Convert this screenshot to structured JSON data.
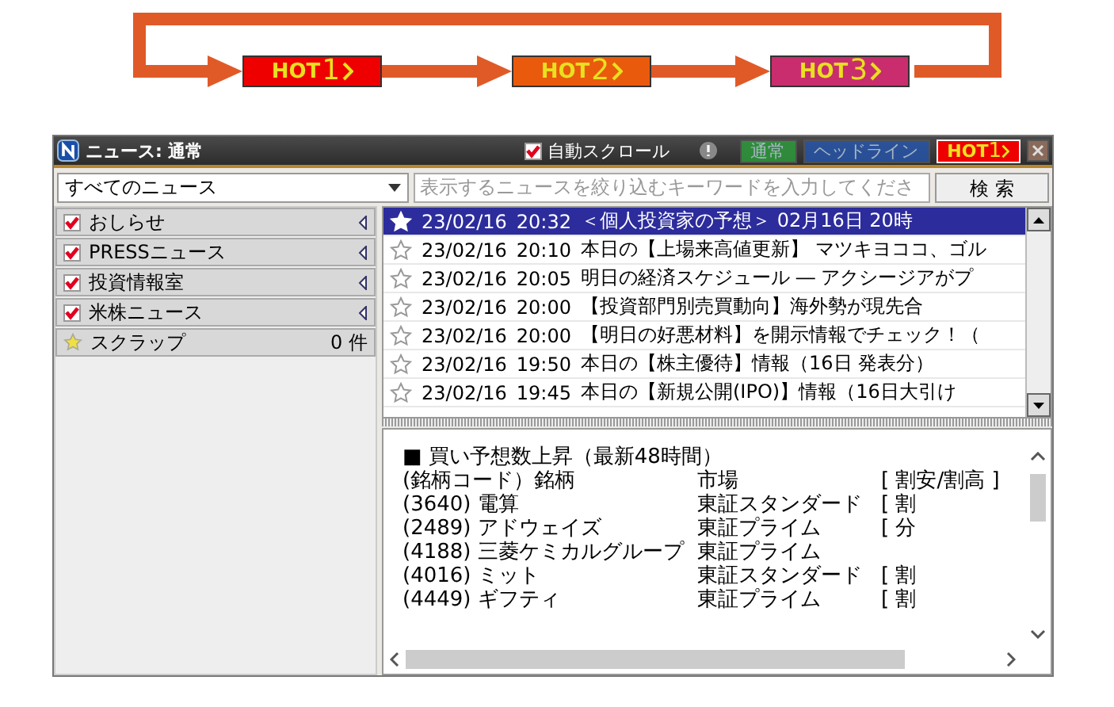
{
  "diagram": {
    "badges": [
      {
        "label": "HOT",
        "number": "1",
        "color": "#ee0000"
      },
      {
        "label": "HOT",
        "number": "2",
        "color": "#ea5a0c"
      },
      {
        "label": "HOT",
        "number": "3",
        "color": "#c92d6e"
      }
    ]
  },
  "window": {
    "title": "ニュース: 通常"
  },
  "auto_scroll": {
    "label": "自動スクロール",
    "checked": true
  },
  "mode_tabs": [
    {
      "kind": "normal",
      "label": "通常",
      "selected": false
    },
    {
      "kind": "headline",
      "label": "ヘッドライン",
      "selected": false
    },
    {
      "kind": "hot",
      "label": "HOT",
      "number": "1",
      "selected": true
    }
  ],
  "filter": {
    "value": "すべてのニュース"
  },
  "search": {
    "placeholder": "表示するニュースを絞り込むキーワードを入力してくださ",
    "button": "検 索"
  },
  "categories": [
    {
      "label": "おしらせ",
      "checked": true
    },
    {
      "label": "PRESSニュース",
      "checked": true
    },
    {
      "label": "投資情報室",
      "checked": true
    },
    {
      "label": "米株ニュース",
      "checked": true
    }
  ],
  "scrap": {
    "label": "スクラップ",
    "count": "0 件"
  },
  "news": [
    {
      "date": "23/02/16",
      "time": "20:32",
      "headline": "＜個人投資家の予想＞ 02月16日 20時",
      "selected": true
    },
    {
      "date": "23/02/16",
      "time": "20:10",
      "headline": "本日の【上場来高値更新】 マツキヨココ、ゴル",
      "selected": false
    },
    {
      "date": "23/02/16",
      "time": "20:05",
      "headline": "明日の経済スケジュール ― アクシージアがプ",
      "selected": false
    },
    {
      "date": "23/02/16",
      "time": "20:00",
      "headline": "【投資部門別売買動向】海外勢が現先合",
      "selected": false
    },
    {
      "date": "23/02/16",
      "time": "20:00",
      "headline": "【明日の好悪材料】を開示情報でチェック！（",
      "selected": false
    },
    {
      "date": "23/02/16",
      "time": "19:50",
      "headline": "本日の【株主優待】情報（16日 発表分）",
      "selected": false
    },
    {
      "date": "23/02/16",
      "time": "19:45",
      "headline": "本日の【新規公開(IPO)】情報（16日大引け",
      "selected": false
    }
  ],
  "detail": {
    "title": "■ 買い予想数上昇（最新48時間）",
    "header": {
      "name": "(銘柄コード）銘柄",
      "market": "市場",
      "rating": "[ 割安/割高 ]"
    },
    "rows": [
      {
        "code": "(3640)",
        "name": "電算",
        "market": "東証スタンダード",
        "rating": "[ 割"
      },
      {
        "code": "(2489)",
        "name": "アドウェイズ",
        "market": "東証プライム",
        "rating": "[ 分"
      },
      {
        "code": "(4188)",
        "name": "三菱ケミカルグループ",
        "market": "東証プライム",
        "rating": ""
      },
      {
        "code": "(4016)",
        "name": "ミット",
        "market": "東証スタンダード",
        "rating": "[ 割"
      },
      {
        "code": "(4449)",
        "name": "ギフティ",
        "market": "東証プライム",
        "rating": "[ 割"
      }
    ]
  }
}
